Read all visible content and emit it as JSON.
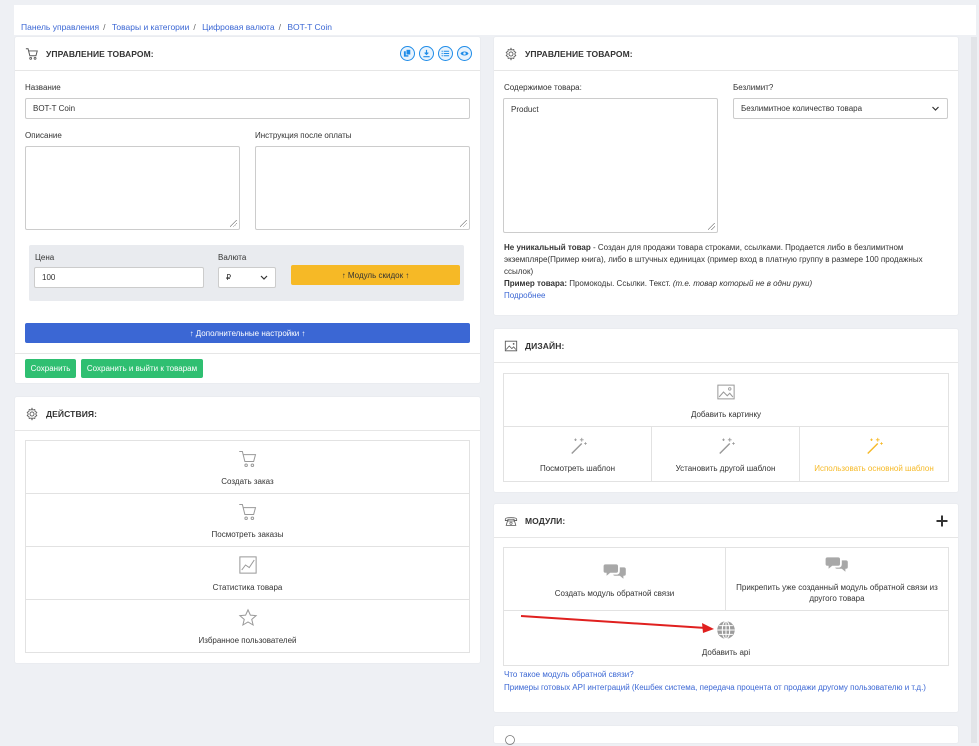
{
  "breadcrumb": [
    "Панель управления",
    "Товары и категории",
    "Цифровая валюта",
    "BOT-T Coin"
  ],
  "left_card": {
    "title": "УПРАВЛЕНИЕ ТОВАРОМ:",
    "name_label": "Название",
    "name_value": "BOT-T Coin",
    "description_label": "Описание",
    "instruction_label": "Инструкция после оплаты",
    "price_label": "Цена",
    "price_value": "100",
    "currency_label": "Валюта",
    "currency_value": "₽",
    "discount_button": "↑ Модуль скидок ↑",
    "extra_settings_button": "↑ Дополнительные настройки ↑",
    "save_button": "Сохранить",
    "save_exit_button": "Сохранить и выйти к товарам",
    "header_icons": [
      "copy-icon",
      "download-icon",
      "list-icon",
      "eye-icon"
    ]
  },
  "actions_card": {
    "title": "ДЕЙСТВИЯ:",
    "items": [
      "Создать заказ",
      "Посмотреть заказы",
      "Статистика товара",
      "Избранное пользователей"
    ]
  },
  "right_card": {
    "title": "УПРАВЛЕНИЕ ТОВАРОМ:",
    "content_label": "Содержимое товара:",
    "content_value": "Product",
    "unlimited_label": "Безлимит?",
    "unlimited_value": "Безлимитное количество товара",
    "info_bold": "Не уникальный товар",
    "info_text": " - Создан для продажи товара строками, ссылками. Продается либо в безлимитном экземпляре(Пример книга), либо в штучных единицах (пример вход в платную группу в размере 100 продажных ссылок)",
    "example_bold": "Пример товара:",
    "example_text": " Промокоды. Ссылки. Текст. ",
    "example_italic": "(т.е. товар который не в одни руки)",
    "more_link": "Подробнее"
  },
  "design_card": {
    "title": "ДИЗАЙН:",
    "add_image": "Добавить картинку",
    "view_template": "Посмотреть шаблон",
    "set_template": "Установить другой шаблон",
    "use_main_template": "Использовать основной шаблон"
  },
  "modules_card": {
    "title": "МОДУЛИ:",
    "create_feedback": "Создать модуль обратной связи",
    "attach_feedback": "Прикрепить уже созданный модуль обратной связи из другого товара",
    "add_api": "Добавить api",
    "what_is_link": "Что такое модуль обратной связи?",
    "examples_link": "Примеры готовых API интеграций (Кешбек система, передача процента от продажи другому пользователю и т.д.)"
  },
  "colors": {
    "primary": "#3b67d4",
    "success": "#2fbf71",
    "warning": "#f6b926",
    "info": "#1f8ce8"
  }
}
